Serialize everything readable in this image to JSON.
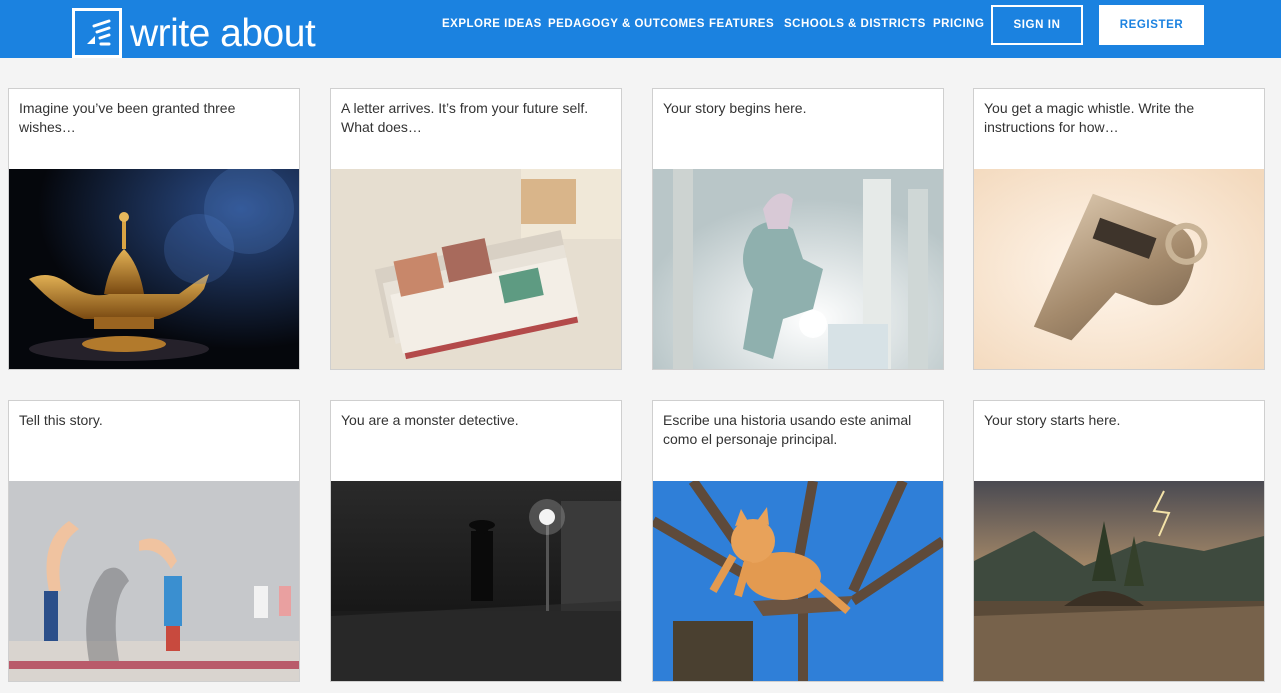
{
  "brand": {
    "name": "write about"
  },
  "nav": {
    "items": [
      "EXPLORE IDEAS",
      "PEDAGOGY & OUTCOMES",
      "FEATURES",
      "SCHOOLS & DISTRICTS",
      "PRICING"
    ],
    "sign_in": "SIGN IN",
    "register": "REGISTER"
  },
  "cards": [
    {
      "prompt": "Imagine you’ve been granted three wishes…",
      "image": "magic-lamp"
    },
    {
      "prompt": "A letter arrives. It’s from your future self. What does…",
      "image": "letters-stack"
    },
    {
      "prompt": "Your story begins here.",
      "image": "carousel-horse"
    },
    {
      "prompt": "You get a magic whistle. Write the instructions for how…",
      "image": "whistle"
    },
    {
      "prompt": "Tell this story.",
      "image": "stretched-people-wall"
    },
    {
      "prompt": "You are a monster detective.",
      "image": "night-street-figure"
    },
    {
      "prompt": "Escribe una historia usando este animal como el personaje principal.",
      "image": "jumping-cat"
    },
    {
      "prompt": "Your story starts here.",
      "image": "lake-island-storm"
    }
  ],
  "colors": {
    "header": "#1b82e0",
    "background": "#f4f4f4",
    "card_border": "#cfcfcf",
    "text": "#333333"
  }
}
